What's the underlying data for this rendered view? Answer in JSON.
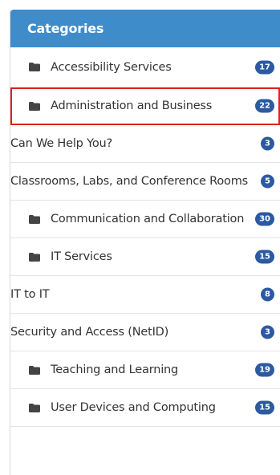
{
  "panel": {
    "title": "Categories",
    "accent_color": "#3f8ccb",
    "badge_color": "#2c5aa0",
    "selected_outline_color": "#e02020"
  },
  "categories": [
    {
      "label": "Accessibility Services",
      "count": "17",
      "icon": "folder-icon"
    },
    {
      "label": "Administration and Business",
      "count": "22",
      "icon": "folder-icon",
      "selected": true
    },
    {
      "label": "Can We Help You?",
      "count": "3",
      "icon": ""
    },
    {
      "label": "Classrooms, Labs, and Conference Rooms",
      "count": "5",
      "icon": ""
    },
    {
      "label": "Communication and Collaboration",
      "count": "30",
      "icon": "folder-icon"
    },
    {
      "label": "IT Services",
      "count": "15",
      "icon": "folder-icon"
    },
    {
      "label": "IT to IT",
      "count": "8",
      "icon": ""
    },
    {
      "label": "Security and Access (NetID)",
      "count": "3",
      "icon": ""
    },
    {
      "label": "Teaching and Learning",
      "count": "19",
      "icon": "folder-icon"
    },
    {
      "label": "User Devices and Computing",
      "count": "15",
      "icon": "folder-icon"
    }
  ]
}
